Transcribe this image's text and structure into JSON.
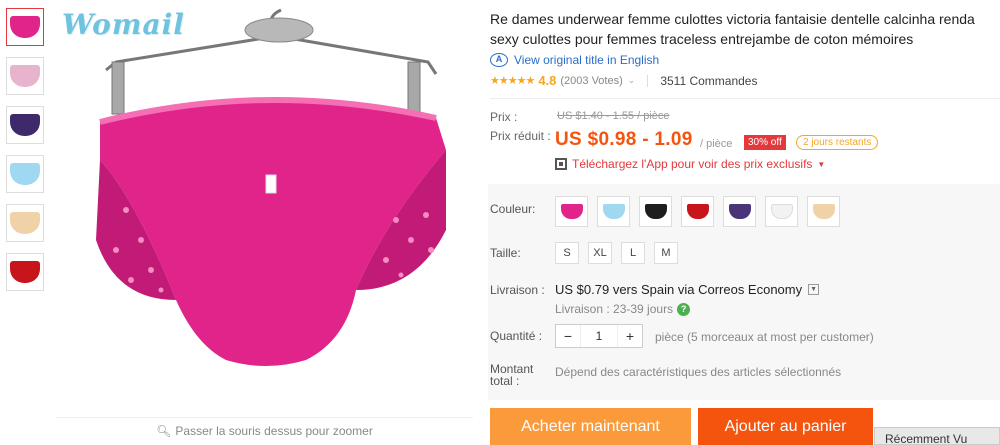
{
  "brand": "Womail",
  "thumbnails": [
    {
      "color": "#e0248a"
    },
    {
      "color": "#e7b3cd"
    },
    {
      "color": "#3e2a6a"
    },
    {
      "color": "#9fd8f0"
    },
    {
      "color": "#efd2a8"
    },
    {
      "color": "#c8141b"
    }
  ],
  "zoom_hint": "Passer la souris dessus pour zoomer",
  "title": "Re dames underwear femme culottes victoria fantaisie dentelle calcinha renda sexy culottes pour femmes traceless entrejambe de coton mémoires",
  "translate_link": "View original title in English",
  "rating": {
    "stars": "★★★★★",
    "score": "4.8",
    "votes": "(2003 Votes)",
    "orders": "3511 Commandes"
  },
  "price": {
    "label_price": "Prix :",
    "original": "US $1.40 - 1.55 / pièce",
    "label_sale": "Prix réduit :",
    "sale": "US $0.98 - 1.09",
    "unit": "/ pièce",
    "discount": "30% off",
    "days_left": "2 jours restants",
    "app_promo": "Téléchargez l'App pour voir des prix exclusifs"
  },
  "options": {
    "color_label": "Couleur:",
    "colors": [
      "#e0248a",
      "#9fd8f0",
      "#1e1e1e",
      "#c8141b",
      "#4a3578",
      "#f2f2f2",
      "#efd2a8"
    ],
    "size_label": "Taille:",
    "sizes": [
      "S",
      "XL",
      "L",
      "M"
    ],
    "shipping_label": "Livraison :",
    "shipping": "US $0.79 vers Spain via Correos Economy",
    "delivery_time": "Livraison : 23-39 jours",
    "quantity_label": "Quantité :",
    "quantity": "1",
    "quantity_note": "pièce (5 morceaux at most per customer)",
    "total_label_1": "Montant",
    "total_label_2": "total :",
    "total_text": "Dépend des caractéristiques des articles sélectionnés"
  },
  "actions": {
    "buy": "Acheter maintenant",
    "cart": "Ajouter au panier"
  },
  "recent": "Récemment Vu"
}
